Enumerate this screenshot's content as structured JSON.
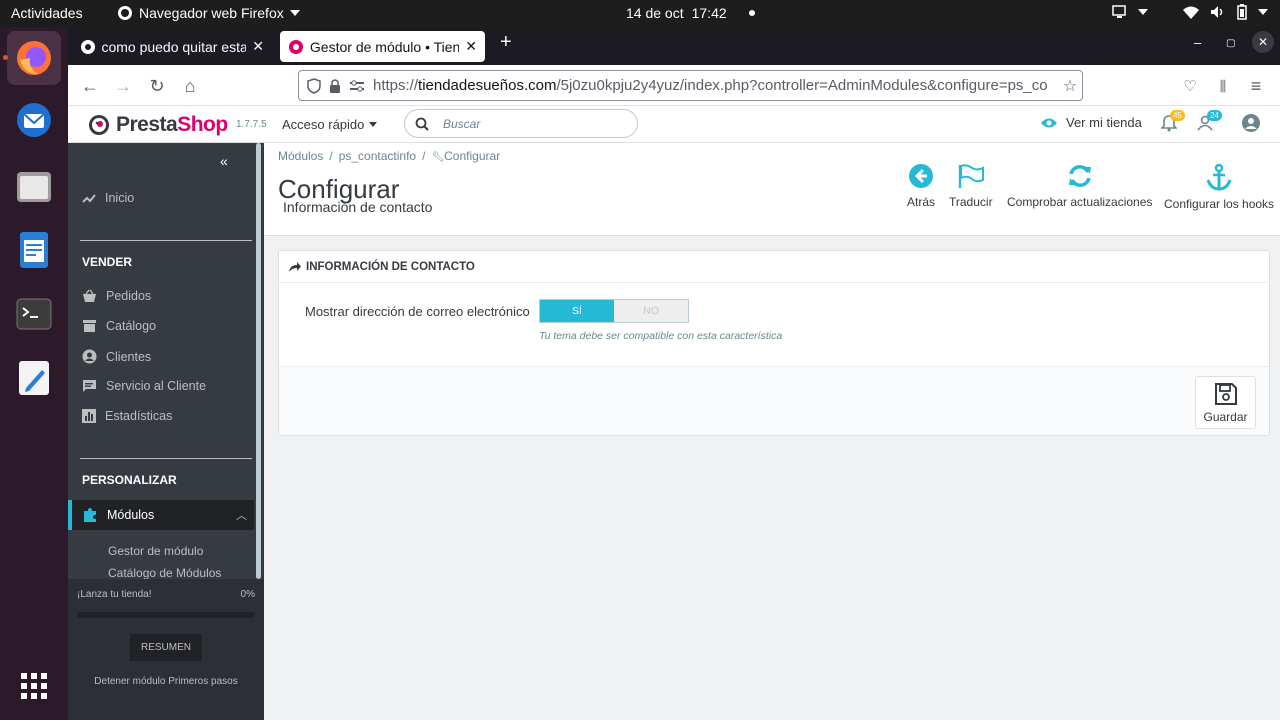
{
  "system_bar": {
    "activities": "Actividades",
    "app_menu": "Navegador web Firefox",
    "date": "14 de oct",
    "time": "17:42"
  },
  "dock": {
    "apps": [
      "firefox-icon",
      "thunderbird-icon",
      "files-icon",
      "writer-icon",
      "terminal-icon",
      "text-editor-icon",
      "app-grid-icon"
    ]
  },
  "browser": {
    "tabs": [
      {
        "title": "como puedo quitar estas",
        "active": false
      },
      {
        "title": "Gestor de módulo • Tiend",
        "active": true
      }
    ],
    "new_tab": "+",
    "url_prefix": "https://",
    "url_host": "tiendadesueños.com",
    "url_path": "/5j0zu0kpju2y4yuz/index.php?controller=AdminModules&configure=ps_co"
  },
  "ps_header": {
    "brand_a": "Presta",
    "brand_b": "Shop",
    "version": "1.7.7.5",
    "quick_access": "Acceso rápido",
    "search_placeholder": "Buscar",
    "view_shop": "Ver mi tienda",
    "orders_badge": "45",
    "customers_badge": "24"
  },
  "sidebar": {
    "home": "Inicio",
    "sell_section": "VENDER",
    "sell_items": [
      "Pedidos",
      "Catálogo",
      "Clientes",
      "Servicio al Cliente",
      "Estadísticas"
    ],
    "custom_section": "PERSONALIZAR",
    "modules": "Módulos",
    "module_subitems": [
      "Gestor de módulo",
      "Catálogo de Módulos"
    ],
    "launch_label": "¡Lanza tu tienda!",
    "launch_progress": "0%",
    "summary_button": "RESUMEN",
    "stop_link": "Detener módulo Primeros pasos"
  },
  "page": {
    "breadcrumb": [
      "Módulos",
      "/",
      "ps_contactinfo",
      "/",
      "Configurar"
    ],
    "title": "Configurar",
    "subtitle": "Información de contacto",
    "toolbar": {
      "back": "Atrás",
      "translate": "Traducir",
      "check_updates": "Comprobar actualizaciones",
      "hooks": "Configurar los hooks"
    }
  },
  "form": {
    "heading": "INFORMACIÓN DE CONTACTO",
    "field_label": "Mostrar dirección de correo electrónico",
    "switch_yes": "SÍ",
    "switch_no": "NO",
    "switch_value": "yes",
    "help": "Tu tema debe ser compatible con esta característica",
    "save": "Guardar"
  },
  "colors": {
    "accent": "#25b9d7",
    "sidebar_bg": "#363a41",
    "brand_pink": "#df0067"
  }
}
